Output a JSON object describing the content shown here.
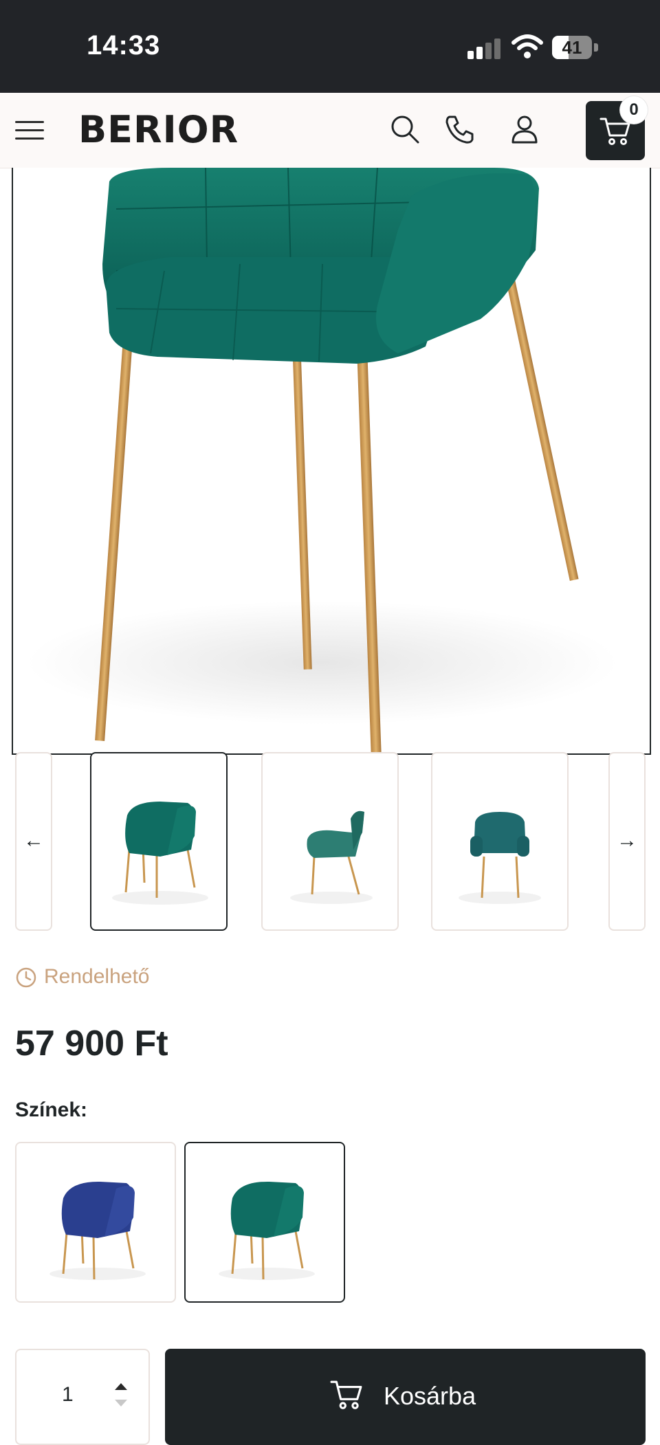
{
  "status_bar": {
    "time": "14:33",
    "battery_percent": "41",
    "battery_level": 0.41,
    "icons": [
      "cellular-signal-icon",
      "wifi-icon",
      "battery-icon"
    ]
  },
  "header": {
    "logo": "BERIOR",
    "icons": [
      "menu-icon",
      "search-icon",
      "phone-icon",
      "user-icon",
      "cart-icon"
    ],
    "cart_count": "0"
  },
  "gallery": {
    "main_image": "green velvet armchair with gold legs",
    "thumbnails": [
      "front view",
      "side view",
      "back view"
    ],
    "prev_icon": "←",
    "next_icon": "→"
  },
  "product": {
    "availability": "Rendelhető",
    "price": "57 900 Ft",
    "colors_label": "Színek:",
    "colors": [
      {
        "name": "blue",
        "hex": "#2a3f8f",
        "selected": false
      },
      {
        "name": "green",
        "hex": "#0f6d62",
        "selected": true
      }
    ],
    "quantity": "1",
    "add_to_cart_label": "Kosárba"
  },
  "colors": {
    "dark": "#1f2426",
    "accent_tan": "#c9a27e",
    "velvet_green": "#0f6d62",
    "gold_legs": "#c8964f"
  }
}
